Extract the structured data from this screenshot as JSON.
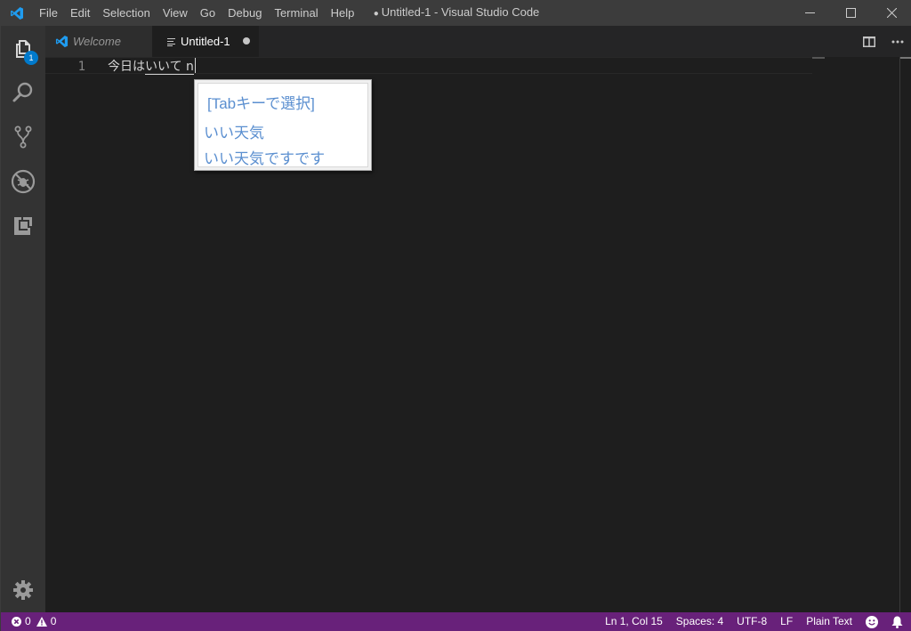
{
  "titlebar": {
    "title_dot": "●",
    "title": "Untitled-1 - Visual Studio Code",
    "menu": [
      "File",
      "Edit",
      "Selection",
      "View",
      "Go",
      "Debug",
      "Terminal",
      "Help"
    ]
  },
  "activitybar": {
    "items": [
      {
        "name": "explorer",
        "icon": "files-icon",
        "badge": "1"
      },
      {
        "name": "search",
        "icon": "search-icon"
      },
      {
        "name": "source-control",
        "icon": "source-control-icon"
      },
      {
        "name": "debug",
        "icon": "debug-icon"
      },
      {
        "name": "extensions",
        "icon": "extensions-icon"
      }
    ],
    "settings_icon": "gear-icon"
  },
  "tabs": [
    {
      "label": "Welcome",
      "icon": "vscode-logo-icon",
      "active": false
    },
    {
      "label": "Untitled-1",
      "icon": "text-file-icon",
      "active": true,
      "dirty": true
    }
  ],
  "editor": {
    "lines": [
      {
        "number": "1",
        "committed": "今日は",
        "composing": "いいて n"
      }
    ]
  },
  "ime": {
    "hint": "[Tabキーで選択]",
    "candidates": [
      "いい天気",
      "いい天気ですです"
    ]
  },
  "statusbar": {
    "errors": "0",
    "warnings": "0",
    "position": "Ln 1, Col 15",
    "indentation": "Spaces: 4",
    "encoding": "UTF-8",
    "eol": "LF",
    "language": "Plain Text"
  },
  "colors": {
    "statusbar_bg": "#68217a",
    "badge_bg": "#007acc",
    "accent_blue": "#007acc",
    "ime_text": "#5b8fd0"
  }
}
